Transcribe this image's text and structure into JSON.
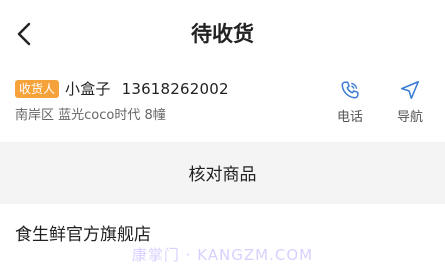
{
  "header": {
    "title": "待收货"
  },
  "receiver": {
    "badge": "收货人",
    "name": "小盒子",
    "phone": "13618262002",
    "address": "南岸区 蓝光coco时代 8幢",
    "actions": {
      "call_label": "电话",
      "navigate_label": "导航"
    }
  },
  "section": {
    "title": "核对商品"
  },
  "shop": {
    "name": "食生鲜官方旗舰店"
  },
  "watermark": {
    "text": "康掌门 · KANGZM.COM"
  },
  "colors": {
    "accent": "#3a7bd5",
    "badge": "#f6a23a",
    "band": "#f4f4f4"
  }
}
